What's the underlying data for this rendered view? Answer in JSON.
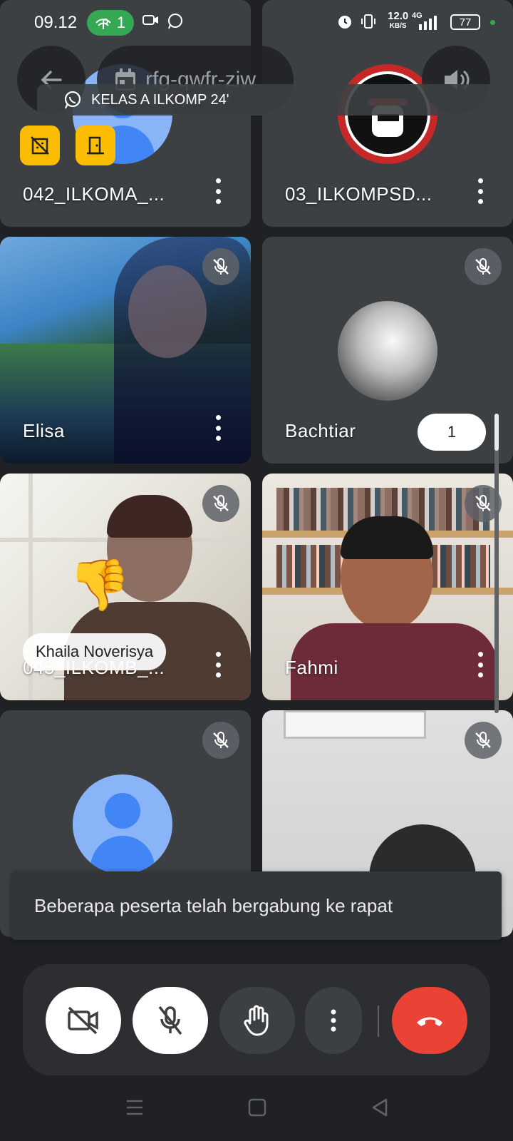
{
  "status_bar": {
    "time": "09.12",
    "hotspot_count": "1",
    "network_speed": "12.0",
    "network_speed_unit": "KB/S",
    "network_type": "4G",
    "battery": "77"
  },
  "top_bar": {
    "meeting_code": "rfg-qwfr-ziw",
    "whatsapp_banner": "KELAS A ILKOMP 24'"
  },
  "tiles": [
    {
      "name": "042_ILKOMA_..."
    },
    {
      "name": "03_ILKOMPSD..."
    },
    {
      "name": "Elisa"
    },
    {
      "name": "Bachtiar"
    },
    {
      "name": "045_ILKOMB_..."
    },
    {
      "name": "Fahmi"
    }
  ],
  "overlays": {
    "participant_count": "1",
    "reaction_name": "Khaila Noverisya",
    "reaction_emoji": "👎"
  },
  "toast": {
    "message": "Beberapa peserta telah bergabung ke rapat"
  },
  "colors": {
    "end_call": "#ea4335",
    "tile_bg": "#3c4043",
    "accent_green": "#34a853"
  }
}
